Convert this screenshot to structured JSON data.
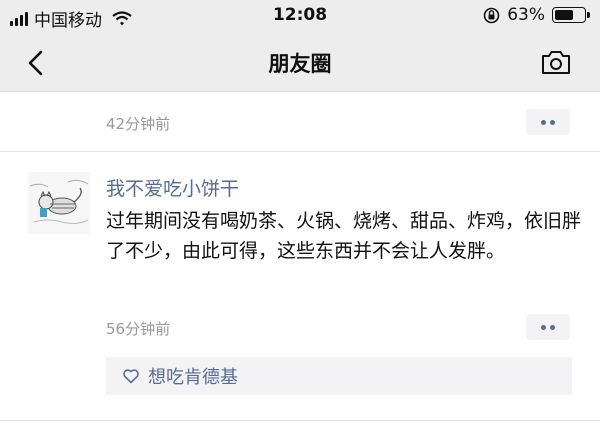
{
  "status": {
    "carrier": "中国移动",
    "time": "12:08",
    "battery": "63%",
    "battery_fraction": 0.63
  },
  "nav": {
    "title": "朋友圈"
  },
  "previous_post": {
    "time": "42分钟前"
  },
  "post": {
    "nickname": "我不爱吃小饼干",
    "content": "过年期间没有喝奶茶、火锅、烧烤、甜品、炸鸡，依旧胖了不少，由此可得，这些东西并不会让人发胖。",
    "time": "56分钟前",
    "likes": [
      "想吃肯德基"
    ]
  },
  "colors": {
    "link": "#576b95",
    "meta": "#999999",
    "bar_bg": "#ededed",
    "like_bg": "#f3f3f5"
  },
  "icons": {
    "back": "chevron-left-icon",
    "camera": "camera-icon",
    "like": "heart-outline-icon",
    "more": "two-dots-icon",
    "wifi": "wifi-icon",
    "lock": "orientation-lock-icon"
  }
}
